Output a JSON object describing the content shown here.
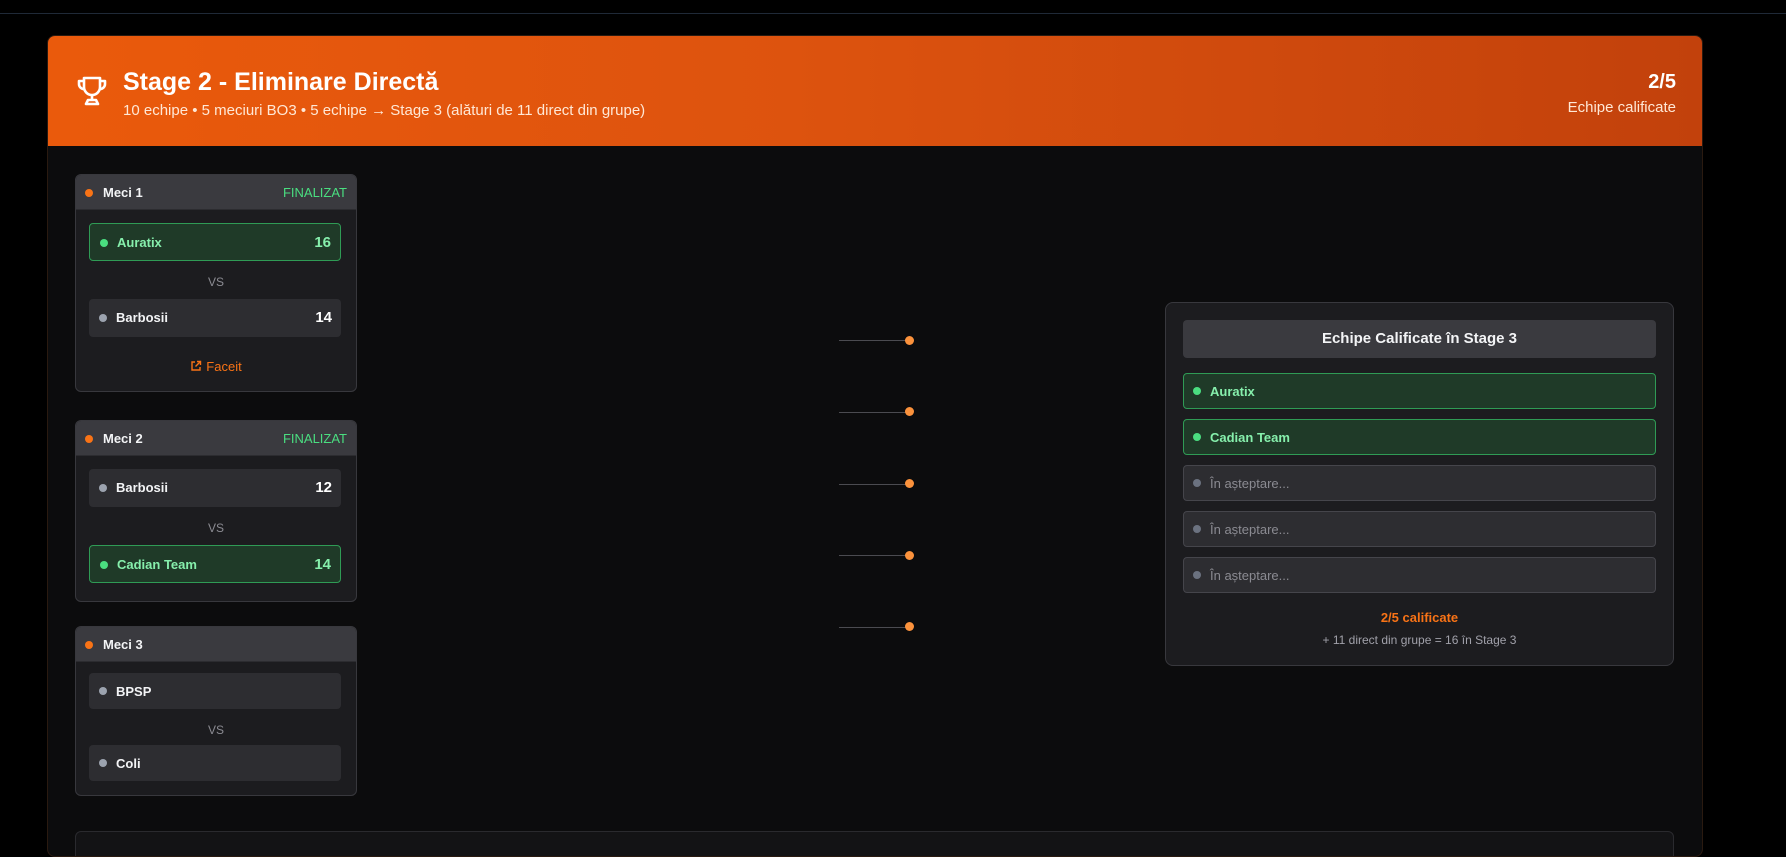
{
  "header": {
    "title": "Stage 2 - Eliminare Directă",
    "subtitle": "10 echipe • 5 meciuri BO3 • 5 echipe → Stage 3 (alături de 11 direct din grupe)",
    "qualified_count": "2/5",
    "qualified_label": "Echipe calificate",
    "trophy_icon": "trophy-icon",
    "accent": "#ea580c"
  },
  "matches": [
    {
      "title": "Meci 1",
      "status": "FINALIZAT",
      "vs": "VS",
      "team1": {
        "name": "Auratix",
        "score": "16",
        "winner": true
      },
      "team2": {
        "name": "Barbosii",
        "score": "14",
        "winner": false
      },
      "link_label": "Faceit",
      "link_icon": "external-link-icon"
    },
    {
      "title": "Meci 2",
      "status": "FINALIZAT",
      "vs": "VS",
      "team1": {
        "name": "Barbosii",
        "score": "12",
        "winner": false
      },
      "team2": {
        "name": "Cadian Team",
        "score": "14",
        "winner": true
      }
    },
    {
      "title": "Meci 3",
      "status": "",
      "vs": "VS",
      "team1": {
        "name": "BPSP",
        "score": "",
        "winner": false
      },
      "team2": {
        "name": "Coli",
        "score": "",
        "winner": false
      }
    }
  ],
  "qualified": {
    "title": "Echipe Calificate în Stage 3",
    "slots": [
      {
        "text": "Auratix",
        "filled": true
      },
      {
        "text": "Cadian Team",
        "filled": true
      },
      {
        "text": "În așteptare...",
        "filled": false
      },
      {
        "text": "În așteptare...",
        "filled": false
      },
      {
        "text": "În așteptare...",
        "filled": false
      }
    ],
    "count": "2/5 calificate",
    "note": "+ 11 direct din grupe = 16 în Stage 3"
  },
  "colors": {
    "win": "#4ade80",
    "pending": "#6b7280",
    "connector": "#fb923c"
  }
}
